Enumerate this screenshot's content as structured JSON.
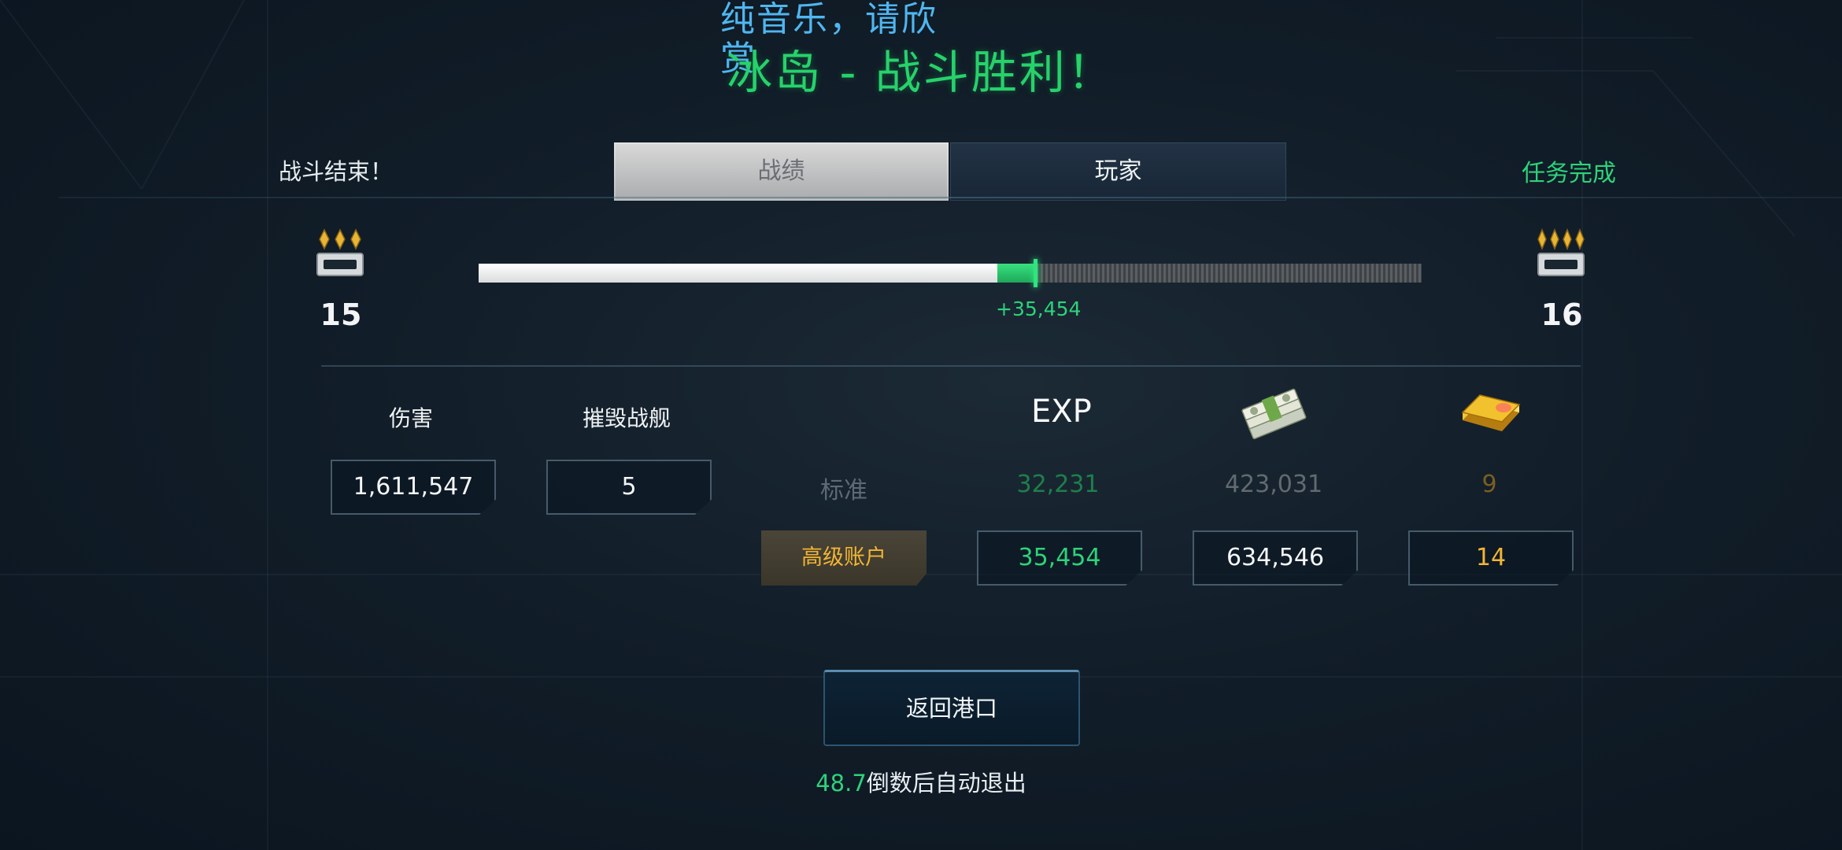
{
  "header": {
    "subtitle": "纯音乐，请欣赏",
    "title": "冰岛 - 战斗胜利！"
  },
  "topbar": {
    "battle_end": "战斗结束！",
    "tabs": [
      {
        "label": "战绩",
        "active": true
      },
      {
        "label": "玩家",
        "active": false
      }
    ],
    "mission_status": "任务完成"
  },
  "rank": {
    "current": "15",
    "next": "16",
    "progress_before": 0.55,
    "progress_after": 0.59,
    "gain_text": "+35,454"
  },
  "stats": {
    "damage_label": "伤害",
    "damage_value": "1,611,547",
    "destroyed_label": "摧毁战舰",
    "destroyed_value": "5"
  },
  "rewards": {
    "columns": [
      {
        "icon": "exp-icon",
        "label": "EXP"
      },
      {
        "icon": "cash-stack-icon"
      },
      {
        "icon": "gold-bar-icon"
      }
    ],
    "standard_label": "标准",
    "standard": [
      "32,231",
      "423,031",
      "9"
    ],
    "premium_label": "高级账户",
    "premium": [
      "35,454",
      "634,546",
      "14"
    ]
  },
  "footer": {
    "return_button": "返回港口",
    "countdown_value": "48.7",
    "countdown_text": "倒数后自动退出"
  },
  "colors": {
    "accent_green": "#2ed27a",
    "title_blue": "#4fb6f0",
    "gold": "#f2b534",
    "background": "#111d28"
  }
}
